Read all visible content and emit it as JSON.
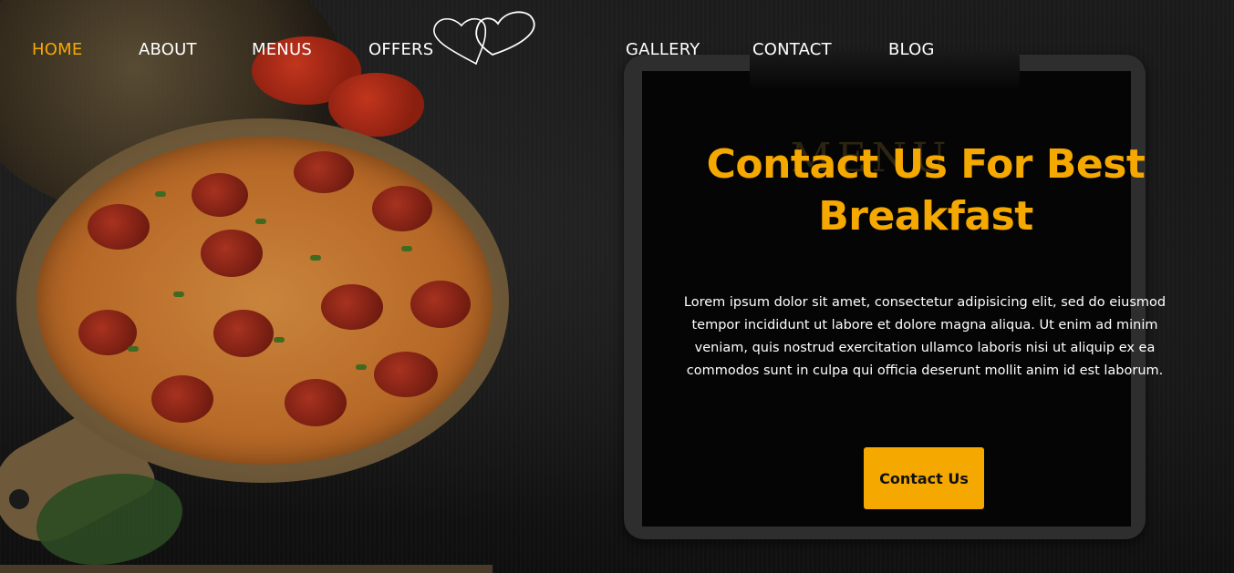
{
  "nav": {
    "items": [
      {
        "label": "HOME",
        "active": true
      },
      {
        "label": "ABOUT",
        "active": false
      },
      {
        "label": "MENUS",
        "active": false
      },
      {
        "label": "OFFERS",
        "active": false
      },
      {
        "label": "GALLERY",
        "active": false
      },
      {
        "label": "CONTACT",
        "active": false
      },
      {
        "label": "BLOG",
        "active": false
      }
    ],
    "logo_icon": "double-heart-icon"
  },
  "hero": {
    "title": "Contact Us For Best Breakfast",
    "description": "Lorem ipsum dolor sit amet, consectetur adipisicing elit, sed do eiusmod tempor incididunt ut labore et dolore magna aliqua. Ut enim ad minim veniam, quis nostrud exercitation ullamco laboris nisi ut aliquip ex ea commodos sunt in culpa qui officia deserunt mollit anim id est laborum.",
    "button_label": "Contact Us"
  },
  "clipboard": {
    "watermark": "MENU"
  },
  "colors": {
    "accent": "#f5a800",
    "text": "#ffffff",
    "background": "#141414"
  }
}
